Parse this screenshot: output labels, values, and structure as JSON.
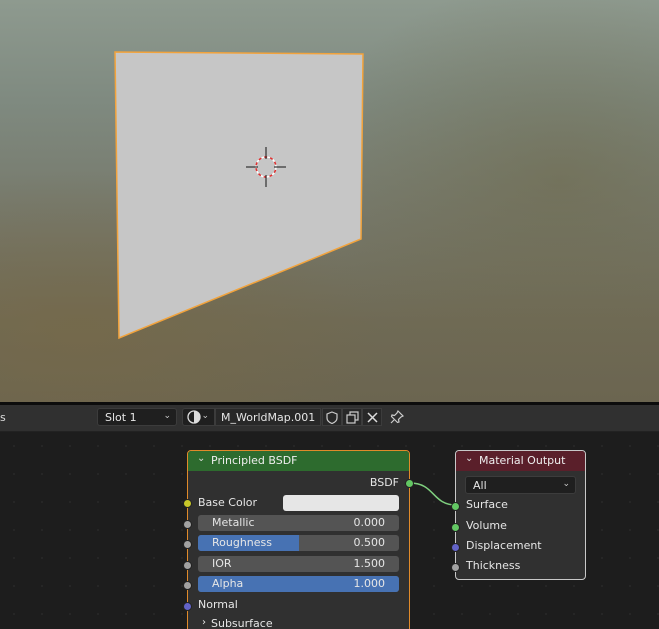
{
  "header": {
    "left_label": "s",
    "slot_label": "Slot 1",
    "material_name": "M_WorldMap.001",
    "icons": [
      "sphere-icon",
      "shield-icon",
      "duplicate-icon",
      "close-icon",
      "pin-icon"
    ]
  },
  "principled": {
    "title": "Principled BSDF",
    "output_label": "BSDF",
    "base_color_label": "Base Color",
    "fields": [
      {
        "label": "Metallic",
        "value": "0.000",
        "fraction": 0.0
      },
      {
        "label": "Roughness",
        "value": "0.500",
        "fraction": 0.5
      },
      {
        "label": "IOR",
        "value": "1.500",
        "fraction": 0.0
      },
      {
        "label": "Alpha",
        "value": "1.000",
        "fraction": 1.0
      }
    ],
    "normal_label": "Normal",
    "subsurface_label": "Subsurface",
    "header_color": "#2d6b2e"
  },
  "output": {
    "title": "Material Output",
    "target": "All",
    "inputs": [
      "Surface",
      "Volume",
      "Displacement",
      "Thickness"
    ],
    "header_color": "#5a1f2a"
  },
  "colors": {
    "selection": "#f2a33c",
    "field_fill": "#4772b3",
    "shader_socket": "#63c763",
    "color_socket": "#c7c729",
    "vector_socket": "#6363c7",
    "float_socket": "#a1a1a1"
  }
}
